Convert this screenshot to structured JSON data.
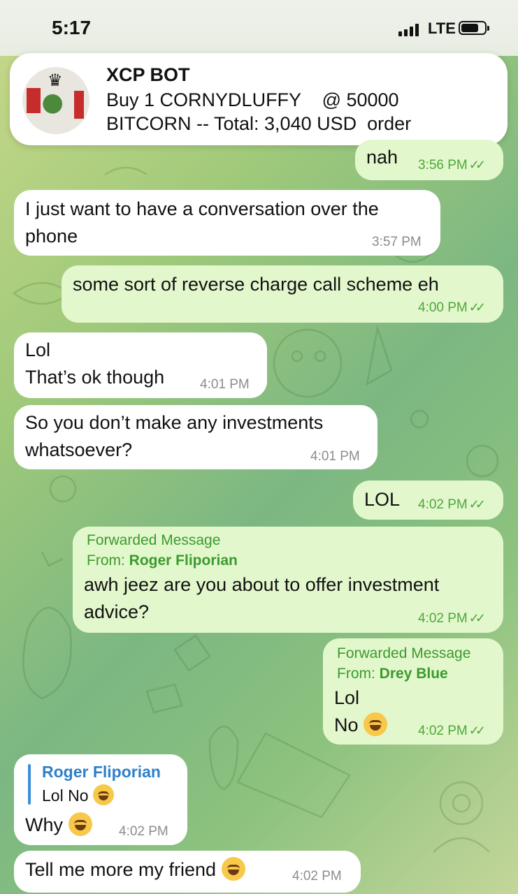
{
  "status": {
    "time": "5:17",
    "network": "LTE"
  },
  "notification": {
    "title": "XCP BOT",
    "line1": "Buy 1 CORNYDLUFFY    @ 50000",
    "line2": "BITCORN -- Total: 3,040 USD  order"
  },
  "messages": [
    {
      "text": "nah",
      "time": "3:56 PM"
    },
    {
      "text1": "I just want to have a conversation over the",
      "text2": "phone",
      "time": "3:57 PM"
    },
    {
      "text": "some sort of reverse charge call scheme eh",
      "time": "4:00 PM"
    },
    {
      "text1": "Lol",
      "text2": "That’s ok though",
      "time": "4:01 PM"
    },
    {
      "text1": "So you don’t make any investments",
      "text2": "whatsoever?",
      "time": "4:01 PM"
    },
    {
      "text": "LOL",
      "time": "4:02 PM"
    },
    {
      "fwd_label": "Forwarded Message",
      "from_label": "From: ",
      "from": "Roger Fliporian",
      "text1": "awh jeez are you about to offer investment",
      "text2": "advice?",
      "time": "4:02 PM"
    },
    {
      "fwd_label": "Forwarded Message",
      "from_label": "From: ",
      "from": "Drey Blue",
      "text1": "Lol",
      "text2": "No",
      "time": "4:02 PM"
    },
    {
      "reply_name": "Roger Fliporian",
      "reply_text": "Lol  No",
      "text": "Why",
      "time": "4:02 PM"
    },
    {
      "text": "Tell me more my friend",
      "time": "4:02 PM"
    }
  ],
  "icons": {
    "read": "double-check-icon",
    "emoji": "tears-of-joy-emoji"
  }
}
